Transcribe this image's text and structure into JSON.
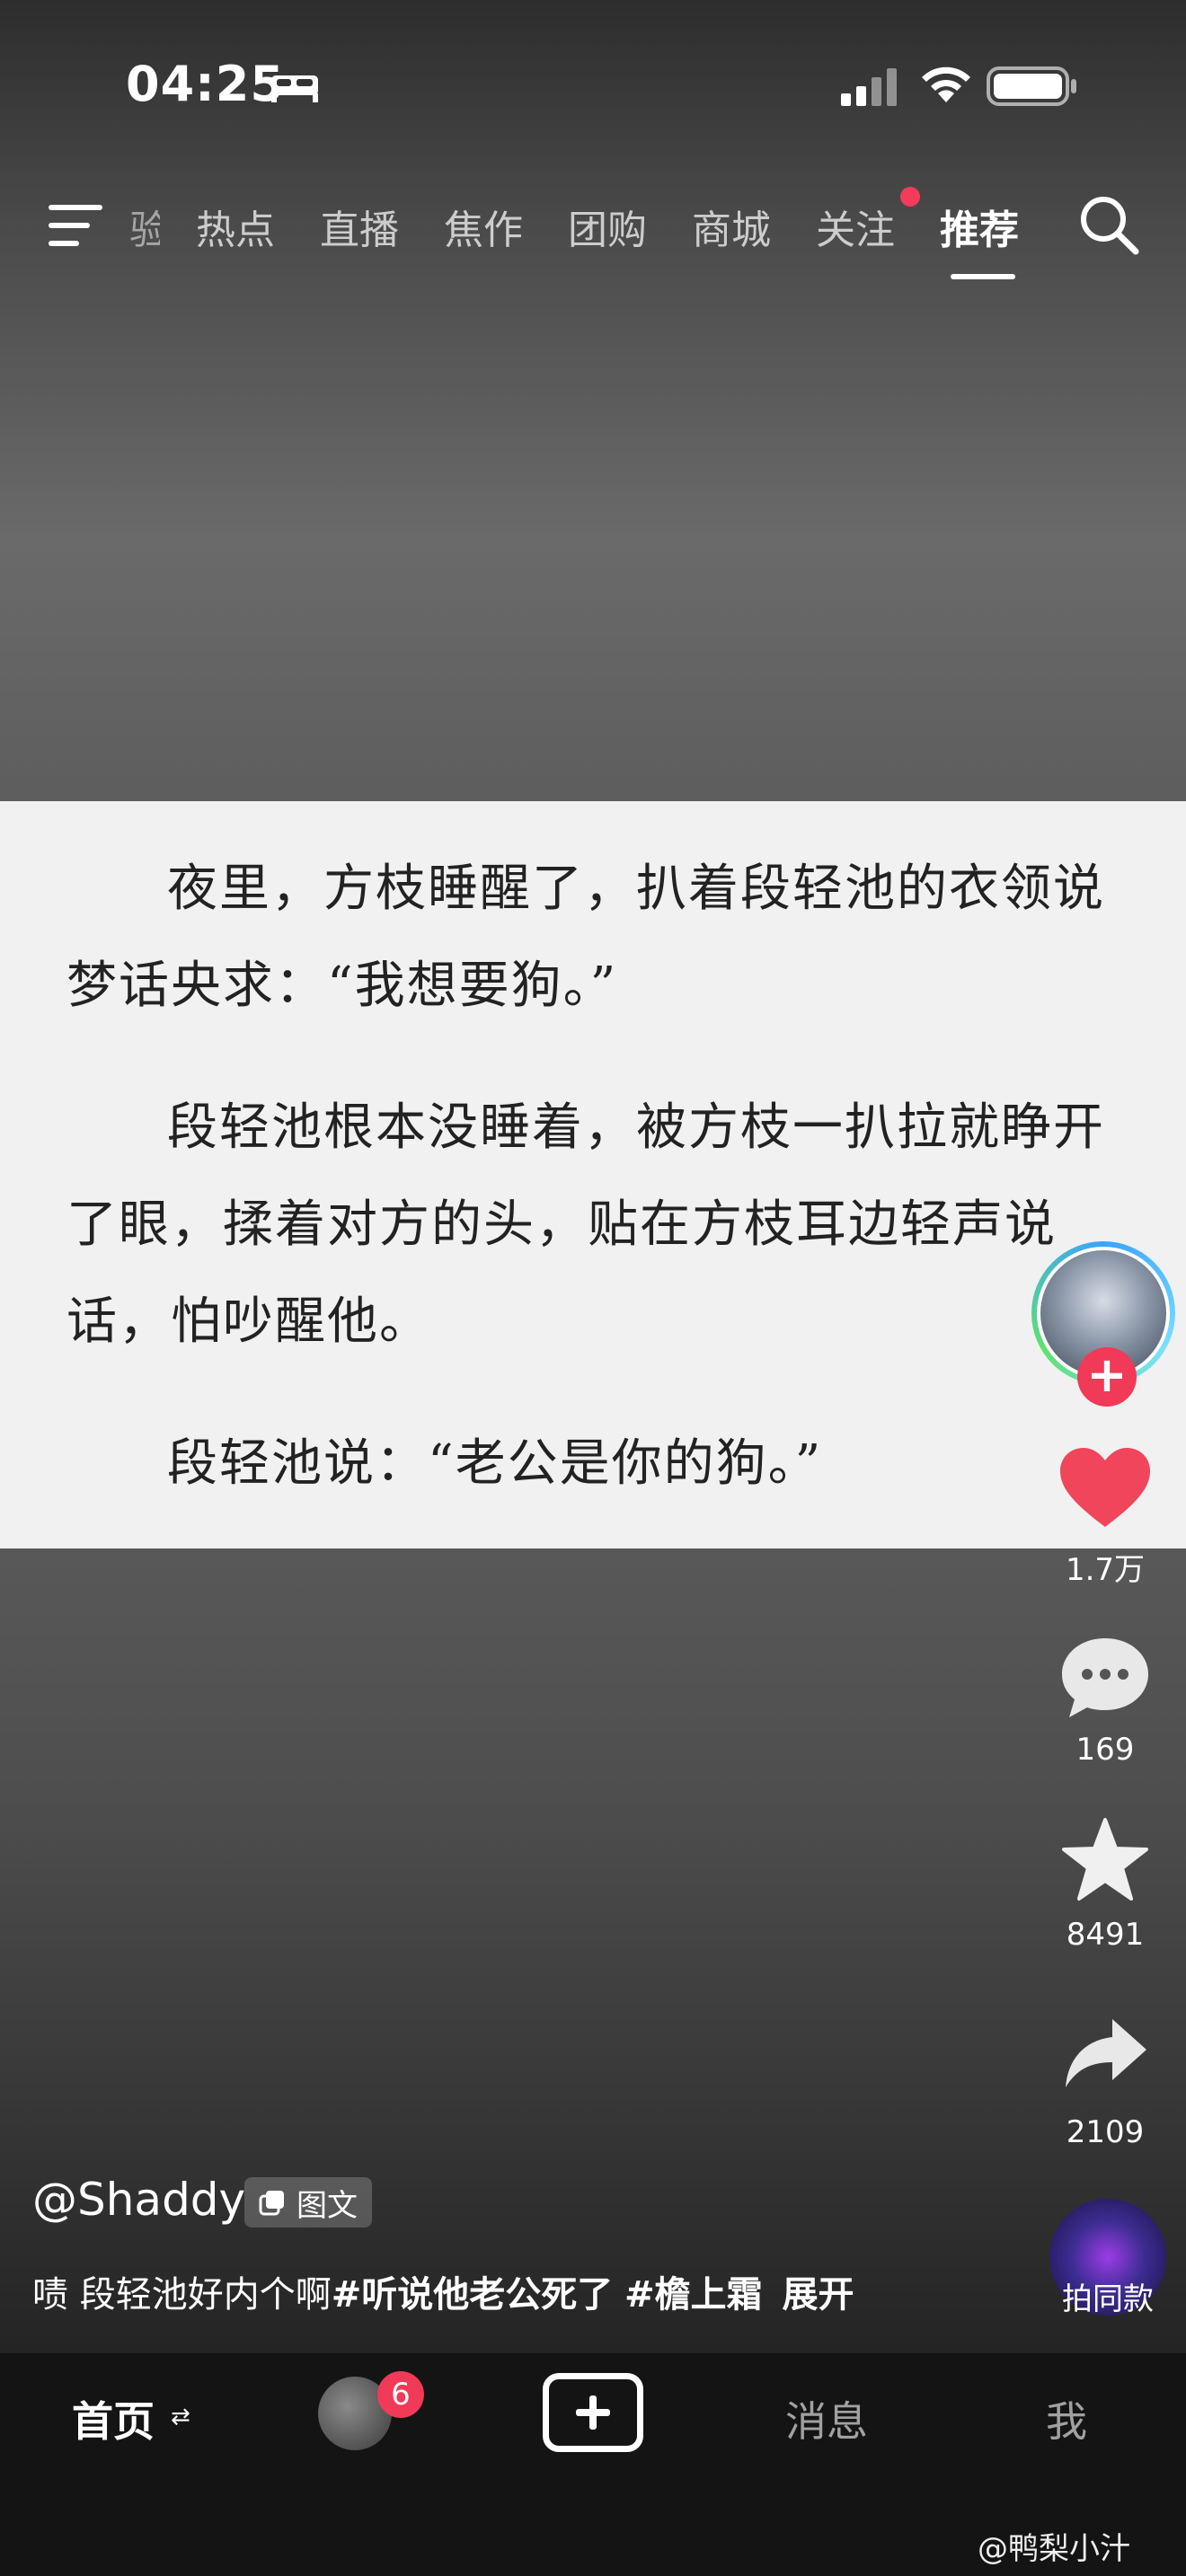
{
  "status": {
    "time": "04:25"
  },
  "nav": {
    "partial": "验",
    "tabs": [
      "热点",
      "直播",
      "焦作",
      "团购",
      "商城",
      "关注",
      "推荐"
    ],
    "active": "推荐"
  },
  "card": {
    "paragraphs": [
      "夜里，方枝睡醒了，扒着段轻池的衣领说梦话央求：“我想要狗。”",
      "段轻池根本没睡着，被方枝一扒拉就睁开了眼，揉着对方的头，贴在方枝耳边轻声说话，怕吵醒他。",
      "段轻池说：“老公是你的狗。”"
    ]
  },
  "rail": {
    "likes": "1.7万",
    "comments": "169",
    "favorites": "8491",
    "shares": "2109",
    "music_label": "拍同款"
  },
  "post": {
    "author": "@Shaddy",
    "type": "图文",
    "caption_prefix": "啧 段轻池好内个啊",
    "tag1": "#听说他老公死了",
    "tag2": "#檐上霜",
    "expand": "展开"
  },
  "bottom": {
    "home": "首页",
    "badge": "6",
    "messages": "消息",
    "me": "我"
  },
  "watermark": "@鸭梨小汁",
  "colors": {
    "accent": "#f03a57",
    "like": "#f0455a"
  }
}
